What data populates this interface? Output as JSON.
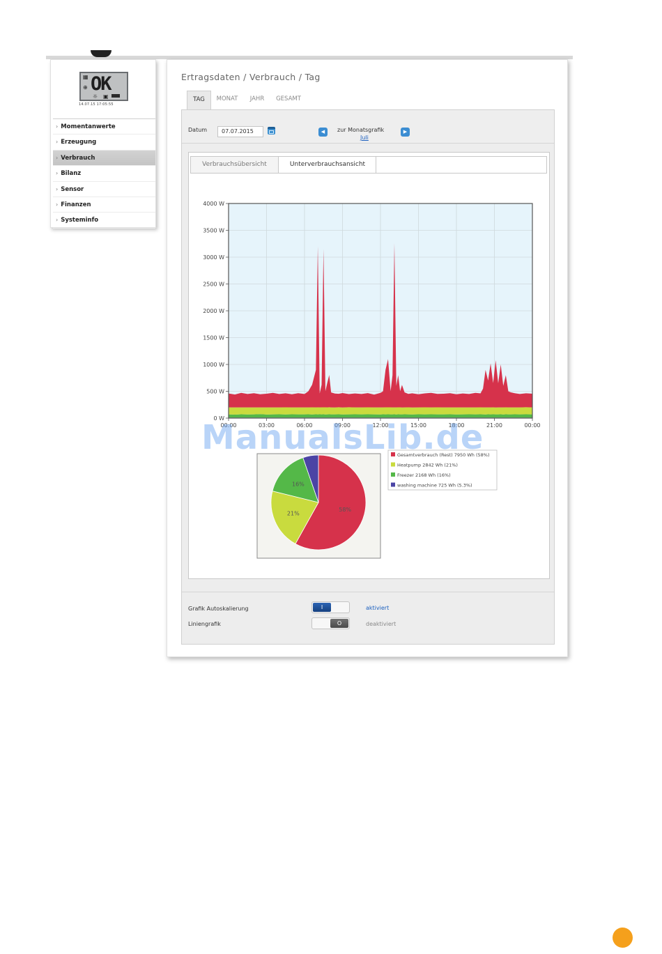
{
  "lcd": {
    "status": "OK",
    "date": "14.07.15 17:05:55"
  },
  "sidebar": {
    "items": [
      {
        "label": "Momentanwerte",
        "active": false
      },
      {
        "label": "Erzeugung",
        "active": false
      },
      {
        "label": "Verbrauch",
        "active": true
      },
      {
        "label": "Bilanz",
        "active": false
      },
      {
        "label": "Sensor",
        "active": false
      },
      {
        "label": "Finanzen",
        "active": false
      },
      {
        "label": "Systeminfo",
        "active": false
      }
    ]
  },
  "header": {
    "breadcrumb": "Ertragsdaten / Verbrauch / Tag"
  },
  "period_tabs": [
    "TAG",
    "MONAT",
    "JAHR",
    "GESAMT"
  ],
  "date_row": {
    "label": "Datum",
    "value": "07.07.2015",
    "month_label": "zur Monatsgrafik",
    "month_link": "Juli"
  },
  "view_tabs": {
    "overview": "Verbrauchsübersicht",
    "sub": "Unterverbrauchsansicht"
  },
  "settings": {
    "autoscale_label": "Grafik Autoskalierung",
    "autoscale_toggle": "I",
    "autoscale_state": "aktiviert",
    "line_label": "Liniengrafik",
    "line_toggle": "O",
    "line_state": "deaktiviert"
  },
  "colors": {
    "red": "#d6324b",
    "yellow": "#c9db3e",
    "green": "#54b848",
    "blue": "#4b44a5",
    "accent": "#3b8dd2",
    "plot_bg": "#e6f4fb"
  },
  "watermark": "ManualsLib.de",
  "chart_data": [
    {
      "type": "area",
      "title": "",
      "xlabel": "",
      "ylabel": "",
      "x_ticks": [
        "00:00",
        "03:00",
        "06:00",
        "09:00",
        "12:00",
        "15:00",
        "18:00",
        "21:00",
        "00:00"
      ],
      "y_ticks": [
        "0 W",
        "500 W",
        "1000 W",
        "1500 W",
        "2000 W",
        "2500 W",
        "3000 W",
        "3500 W",
        "4000 W"
      ],
      "xlim": [
        0,
        24
      ],
      "ylim": [
        0,
        4000
      ],
      "stacked": true,
      "x": [
        0,
        0.5,
        1,
        1.5,
        2,
        2.5,
        3,
        3.5,
        4,
        4.5,
        5,
        5.5,
        6,
        6.3,
        6.6,
        6.9,
        7.05,
        7.2,
        7.35,
        7.5,
        7.65,
        7.8,
        7.95,
        8.1,
        8.4,
        8.7,
        9,
        9.5,
        10,
        10.5,
        11,
        11.5,
        12,
        12.2,
        12.4,
        12.6,
        12.8,
        12.95,
        13.1,
        13.25,
        13.4,
        13.55,
        13.7,
        13.9,
        14.2,
        14.5,
        15,
        15.5,
        16,
        16.5,
        17,
        17.5,
        18,
        18.5,
        19,
        19.5,
        19.9,
        20.1,
        20.3,
        20.5,
        20.7,
        20.9,
        21.1,
        21.3,
        21.5,
        21.7,
        21.9,
        22.1,
        22.3,
        22.6,
        23,
        23.5,
        24
      ],
      "series": [
        {
          "name": "washing machine",
          "values": [
            10,
            10,
            10,
            10,
            10,
            10,
            10,
            10,
            10,
            10,
            10,
            10,
            10,
            10,
            10,
            10,
            10,
            10,
            10,
            10,
            10,
            10,
            10,
            10,
            10,
            10,
            10,
            10,
            10,
            10,
            10,
            10,
            10,
            10,
            10,
            10,
            10,
            10,
            10,
            10,
            10,
            10,
            10,
            10,
            10,
            10,
            10,
            10,
            10,
            10,
            10,
            10,
            10,
            10,
            10,
            10,
            10,
            10,
            10,
            10,
            10,
            10,
            10,
            10,
            10,
            10,
            10,
            10,
            10,
            10,
            10,
            10,
            10
          ]
        },
        {
          "name": "Freezer",
          "values": [
            60,
            55,
            62,
            58,
            60,
            64,
            57,
            60,
            62,
            58,
            61,
            59,
            60,
            62,
            58,
            61,
            60,
            62,
            59,
            61,
            58,
            60,
            62,
            59,
            60,
            61,
            58,
            60,
            62,
            59,
            61,
            60,
            58,
            62,
            60,
            61,
            59,
            60,
            62,
            58,
            61,
            60,
            59,
            62,
            60,
            58,
            61,
            60,
            62,
            59,
            60,
            61,
            58,
            60,
            62,
            59,
            61,
            60,
            58,
            62,
            60,
            61,
            59,
            60,
            62,
            58,
            61,
            60,
            59,
            62,
            60,
            61,
            60
          ]
        },
        {
          "name": "Heatpump",
          "values": [
            130,
            135,
            128,
            132,
            130,
            126,
            133,
            130,
            128,
            134,
            129,
            131,
            130,
            128,
            134,
            129,
            131,
            128,
            132,
            130,
            134,
            129,
            131,
            130,
            128,
            132,
            130,
            133,
            128,
            131,
            130,
            129,
            132,
            128,
            131,
            130,
            133,
            129,
            128,
            132,
            130,
            131,
            129,
            128,
            132,
            130,
            129,
            131,
            128,
            133,
            130,
            129,
            132,
            130,
            128,
            131,
            130,
            129,
            132,
            128,
            130,
            131,
            129,
            130,
            128,
            132,
            130,
            129,
            131,
            128,
            130,
            132,
            130
          ]
        },
        {
          "name": "Gesamtverbrauch (Rest)",
          "values": [
            260,
            240,
            270,
            250,
            265,
            245,
            255,
            270,
            250,
            260,
            245,
            265,
            250,
            300,
            420,
            700,
            3000,
            260,
            420,
            2950,
            300,
            460,
            600,
            280,
            260,
            250,
            270,
            245,
            260,
            250,
            265,
            240,
            270,
            300,
            700,
            900,
            300,
            600,
            3060,
            400,
            600,
            300,
            420,
            280,
            250,
            265,
            245,
            260,
            270,
            250,
            255,
            265,
            245,
            260,
            250,
            270,
            260,
            350,
            700,
            500,
            820,
            450,
            880,
            450,
            800,
            400,
            600,
            300,
            280,
            265,
            250,
            260,
            255
          ]
        }
      ]
    },
    {
      "type": "pie",
      "title": "",
      "categories": [
        "Gesamtverbrauch (Rest)",
        "Heatpump",
        "Freezer",
        "washing machine"
      ],
      "values": [
        7950,
        2842,
        2168,
        725
      ],
      "percent_labels": [
        "58%",
        "21%",
        "16%",
        ""
      ],
      "legend": [
        "Gesamtverbrauch (Rest) 7950 Wh (58%)",
        "Heatpump 2842 Wh (21%)",
        "Freezer 2168 Wh (16%)",
        "washing machine 725 Wh (5.3%)"
      ],
      "legend_position": "right"
    }
  ]
}
